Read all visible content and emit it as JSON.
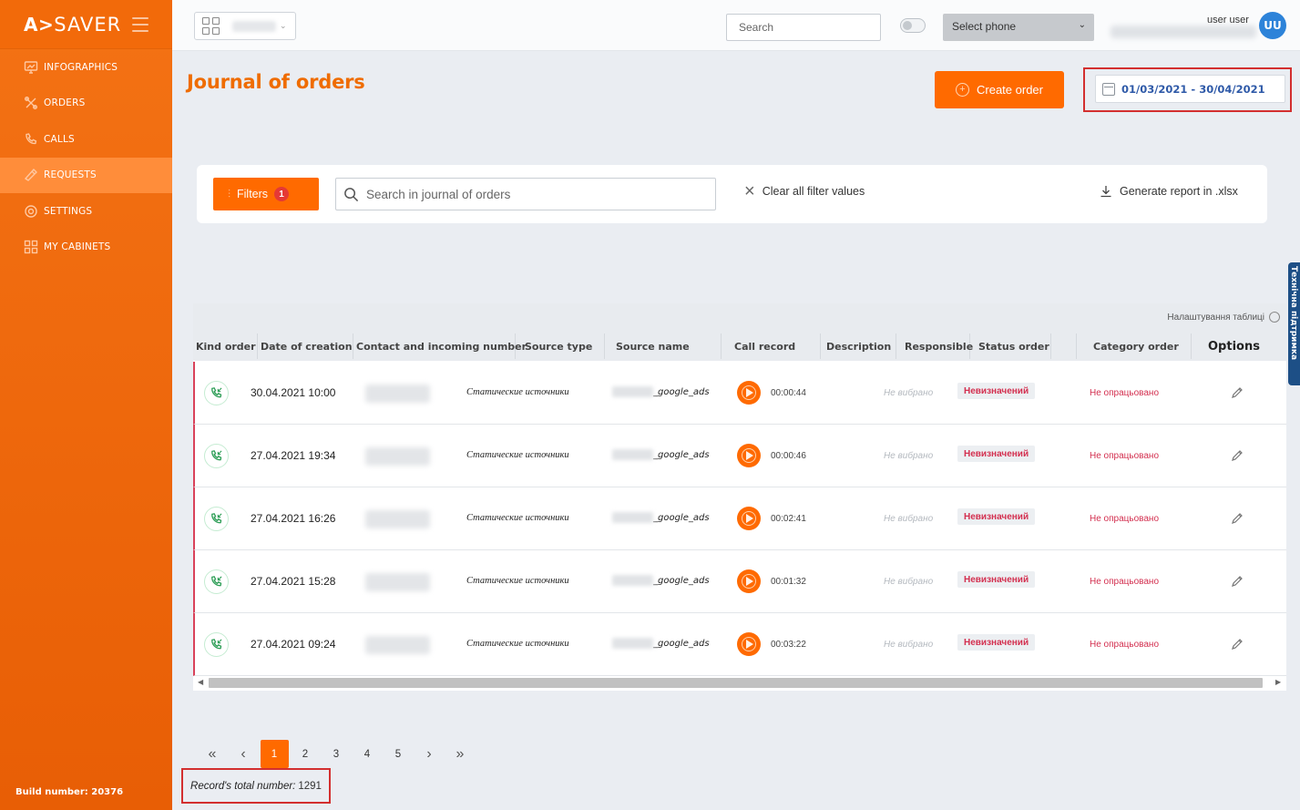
{
  "brand": {
    "logo": "A>",
    "name": "SAVER"
  },
  "sidebar": {
    "items": [
      {
        "label": "INFOGRAPHICS",
        "icon": "infographics-icon",
        "active": false
      },
      {
        "label": "ORDERS",
        "icon": "orders-icon",
        "active": false
      },
      {
        "label": "CALLS",
        "icon": "phone-icon",
        "active": false
      },
      {
        "label": "REQUESTS",
        "icon": "requests-icon",
        "active": true
      },
      {
        "label": "SETTINGS",
        "icon": "gear-icon",
        "active": false
      },
      {
        "label": "MY CABINETS",
        "icon": "cabinets-icon",
        "active": false
      }
    ],
    "build": "Build number: 20376"
  },
  "header": {
    "search_placeholder": "Search",
    "select_phone": "Select phone",
    "user_name": "user user",
    "avatar_initials": "UU"
  },
  "page": {
    "title": "Journal of orders",
    "create_order": "Create order",
    "date_range": "01/03/2021 - 30/04/2021"
  },
  "filters": {
    "filters_label": "Filters",
    "filters_count": "1",
    "search_placeholder": "Search in journal of orders",
    "clear_all": "Clear all filter values",
    "generate_report": "Generate report in .xlsx"
  },
  "table": {
    "settings_label": "Налаштування таблиці",
    "columns": [
      "Kind order",
      "Date of creation",
      "Contact and incoming number",
      "Source type",
      "Source name",
      "Call record",
      "Description",
      "Responsible",
      "Status order",
      "",
      "Category order",
      "Options"
    ],
    "rows": [
      {
        "date": "30.04.2021 10:00",
        "source_type": "Статические источники",
        "source_name": "_google_ads",
        "duration": "00:00:44",
        "responsible": "Не вибрано",
        "status": "Невизначений",
        "category": "Не опрацьовано"
      },
      {
        "date": "27.04.2021 19:34",
        "source_type": "Статические источники",
        "source_name": "_google_ads",
        "duration": "00:00:46",
        "responsible": "Не вибрано",
        "status": "Невизначений",
        "category": "Не опрацьовано"
      },
      {
        "date": "27.04.2021 16:26",
        "source_type": "Статические источники",
        "source_name": "_google_ads",
        "duration": "00:02:41",
        "responsible": "Не вибрано",
        "status": "Невизначений",
        "category": "Не опрацьовано"
      },
      {
        "date": "27.04.2021 15:28",
        "source_type": "Статические источники",
        "source_name": "_google_ads",
        "duration": "00:01:32",
        "responsible": "Не вибрано",
        "status": "Невизначений",
        "category": "Не опрацьовано"
      },
      {
        "date": "27.04.2021 09:24",
        "source_type": "Статические источники",
        "source_name": "_google_ads",
        "duration": "00:03:22",
        "responsible": "Не вибрано",
        "status": "Невизначений",
        "category": "Не опрацьовано"
      }
    ]
  },
  "side_tab": "Технічна підтримка",
  "pagination": {
    "pages": [
      "1",
      "2",
      "3",
      "4",
      "5"
    ],
    "current": "1",
    "total_label": "Record's total number:",
    "total_value": "1291"
  },
  "colors": {
    "accent": "#ff6a00",
    "sidebar": "#f26a0a",
    "title": "#ef6c00",
    "status": "#d32f4f",
    "date": "#2f5aa8"
  }
}
